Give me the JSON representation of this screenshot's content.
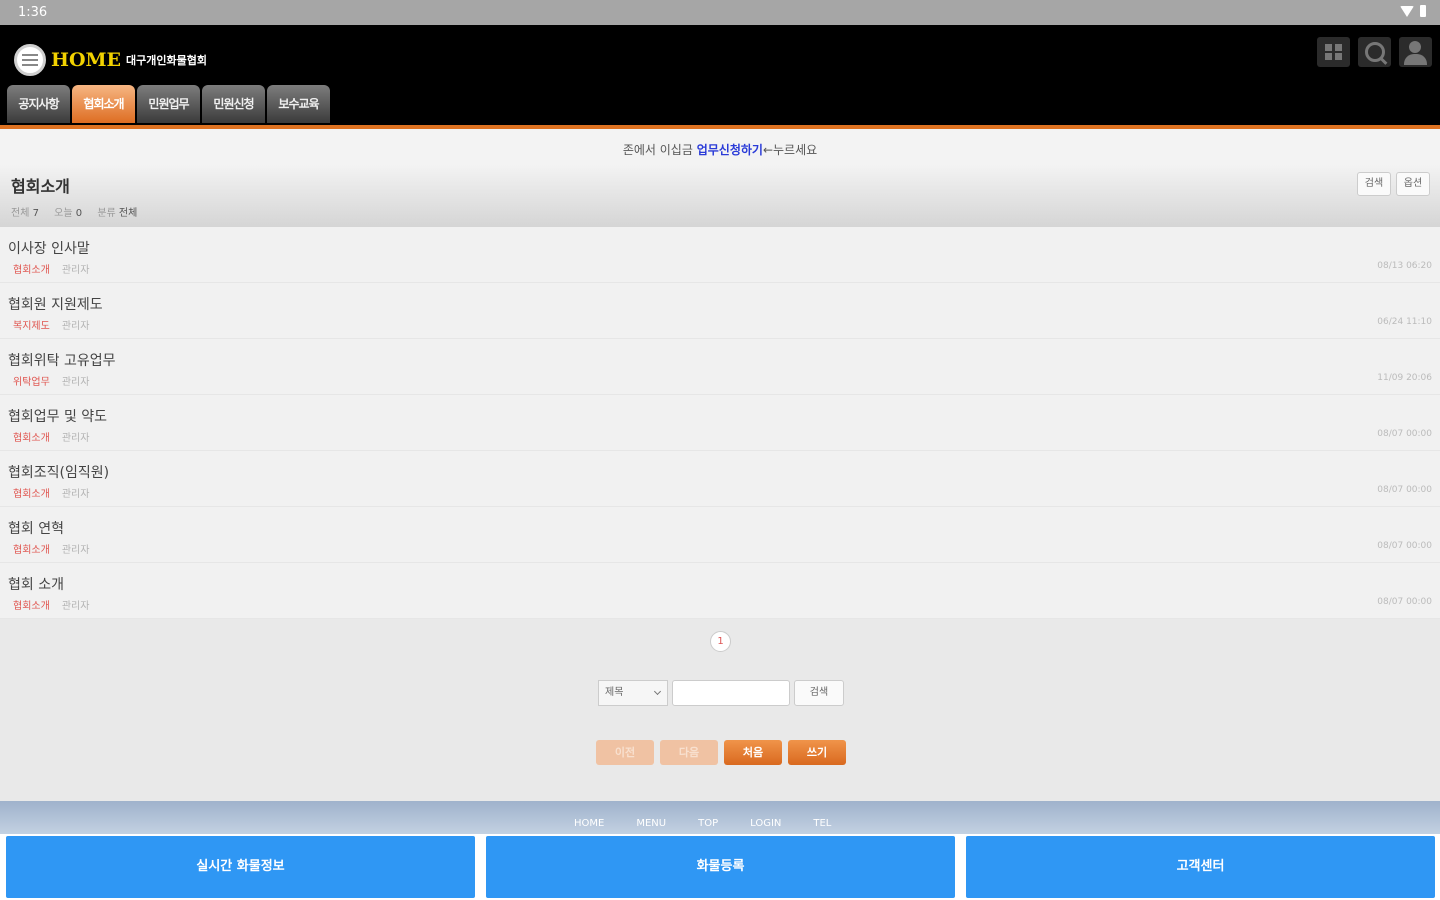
{
  "status_bar": {
    "time": "1:36"
  },
  "header": {
    "logo_text": "HOME",
    "org_name": "대구개인화물협회",
    "icons": [
      "grid-icon",
      "search-icon",
      "user-icon"
    ]
  },
  "tabs": [
    {
      "label": "공지사항",
      "active": false
    },
    {
      "label": "협회소개",
      "active": true
    },
    {
      "label": "민원업무",
      "active": false
    },
    {
      "label": "민원신청",
      "active": false
    },
    {
      "label": "보수교육",
      "active": false
    }
  ],
  "notice": {
    "before": "존에서 이십금",
    "link": "업무신청하기",
    "after": "←누르세요"
  },
  "board": {
    "title": "협회소개",
    "meta": [
      {
        "label": "전체",
        "value": "7"
      },
      {
        "label": "오늘",
        "value": "0"
      },
      {
        "label": "분류",
        "value": "전체"
      }
    ],
    "head_buttons": [
      "검색",
      "옵션"
    ]
  },
  "items": [
    {
      "title": "이사장 인사말",
      "category": "협회소개",
      "author": "관리자",
      "date": "08/13 06:20"
    },
    {
      "title": "협회원 지원제도",
      "category": "복지제도",
      "author": "관리자",
      "date": "06/24 11:10"
    },
    {
      "title": "협회위탁 고유업무",
      "category": "위탁업무",
      "author": "관리자",
      "date": "11/09 20:06"
    },
    {
      "title": "협회업무 및 약도",
      "category": "협회소개",
      "author": "관리자",
      "date": "08/07 00:00"
    },
    {
      "title": "협회조직(임직원)",
      "category": "협회소개",
      "author": "관리자",
      "date": "08/07 00:00"
    },
    {
      "title": "협회 연혁",
      "category": "협회소개",
      "author": "관리자",
      "date": "08/07 00:00"
    },
    {
      "title": "협회 소개",
      "category": "협회소개",
      "author": "관리자",
      "date": "08/07 00:00"
    }
  ],
  "pager": {
    "current": "1"
  },
  "search": {
    "select_value": "제목",
    "input_value": "",
    "button_label": "검색"
  },
  "actions": [
    {
      "label": "이전",
      "disabled": true
    },
    {
      "label": "다음",
      "disabled": true
    },
    {
      "label": "처음",
      "disabled": false
    },
    {
      "label": "쓰기",
      "disabled": false
    }
  ],
  "footer_links": [
    "HOME",
    "MENU",
    "TOP",
    "LOGIN",
    "TEL"
  ],
  "bottom_buttons": [
    "실시간 화물정보",
    "화물등록",
    "고객센터"
  ],
  "colors": {
    "accent": "#de7221",
    "brand_blue": "#2f97f4",
    "link": "#2a3bd8"
  }
}
